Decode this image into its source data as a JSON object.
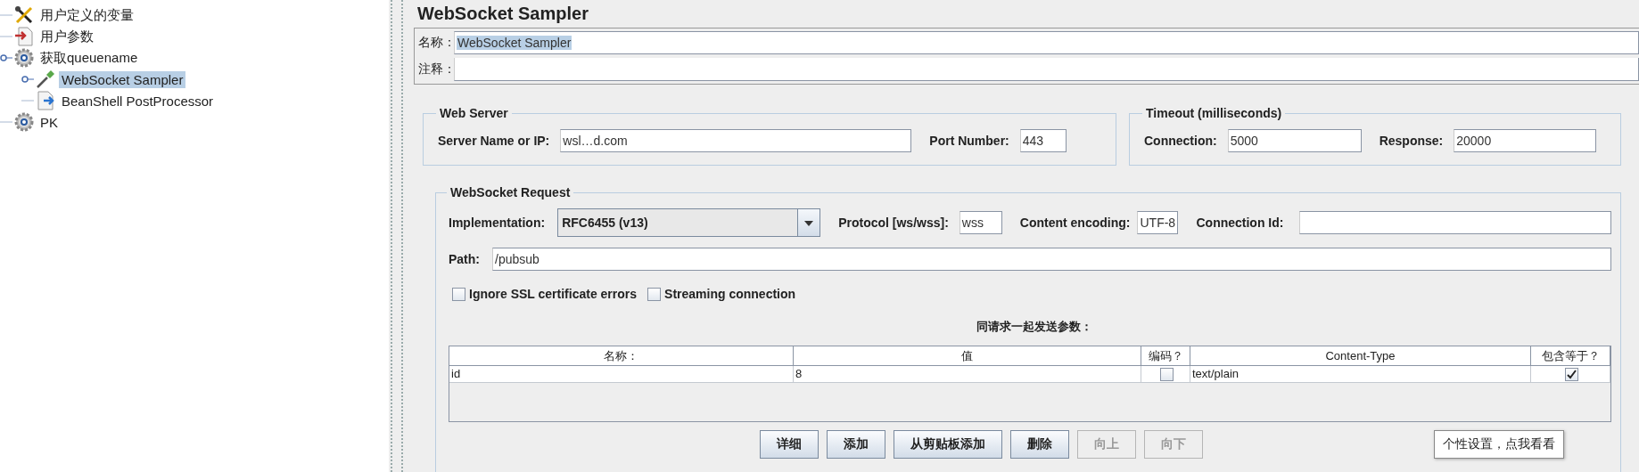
{
  "tree": [
    {
      "label": "用户定义的变量",
      "kind": "variables",
      "selected": false
    },
    {
      "label": "用户参数",
      "kind": "parameters",
      "selected": false
    },
    {
      "label": "获取queuename",
      "kind": "thread-group",
      "selected": false,
      "children": [
        {
          "label": "WebSocket Sampler",
          "kind": "sampler",
          "selected": true
        },
        {
          "label": "BeanShell PostProcessor",
          "kind": "post-processor",
          "selected": false
        }
      ]
    },
    {
      "label": "PK",
      "kind": "thread-group",
      "selected": false
    }
  ],
  "panel": {
    "title": "WebSocket Sampler",
    "name_label": "名称：",
    "name_value": "WebSocket Sampler",
    "comment_label": "注释："
  },
  "web_server": {
    "title": "Web Server",
    "server_label": "Server Name or IP:",
    "server_value": "wsl…d.com",
    "port_label": "Port Number:",
    "port_value": "443"
  },
  "timeout": {
    "title": "Timeout (milliseconds)",
    "connection_label": "Connection:",
    "connection_value": "5000",
    "response_label": "Response:",
    "response_value": "20000"
  },
  "request": {
    "title": "WebSocket Request",
    "implementation_label": "Implementation:",
    "implementation_value": "RFC6455 (v13)",
    "protocol_label": "Protocol [ws/wss]:",
    "protocol_value": "wss",
    "encoding_label": "Content encoding:",
    "encoding_value": "UTF-8",
    "connection_id_label": "Connection Id:",
    "path_label": "Path:",
    "path_value": "/pubsub",
    "checkboxes": [
      {
        "label": "Ignore SSL certificate errors",
        "checked": false
      },
      {
        "label": "Streaming connection",
        "checked": false
      }
    ],
    "table": {
      "title": "同请求一起发送参数：",
      "columns": [
        "名称：",
        "值",
        "编码？",
        "Content-Type",
        "包含等于？"
      ],
      "rows": [
        {
          "name": "id",
          "value": "8",
          "encode": false,
          "content_type": "text/plain",
          "include_equals": true
        }
      ]
    },
    "buttons": [
      {
        "label": "详细",
        "disabled": false
      },
      {
        "label": "添加",
        "disabled": false
      },
      {
        "label": "从剪贴板添加",
        "disabled": false
      },
      {
        "label": "删除",
        "disabled": false
      },
      {
        "label": "向上",
        "disabled": true
      },
      {
        "label": "向下",
        "disabled": true
      }
    ]
  },
  "tooltip": "个性设置，点我看看"
}
